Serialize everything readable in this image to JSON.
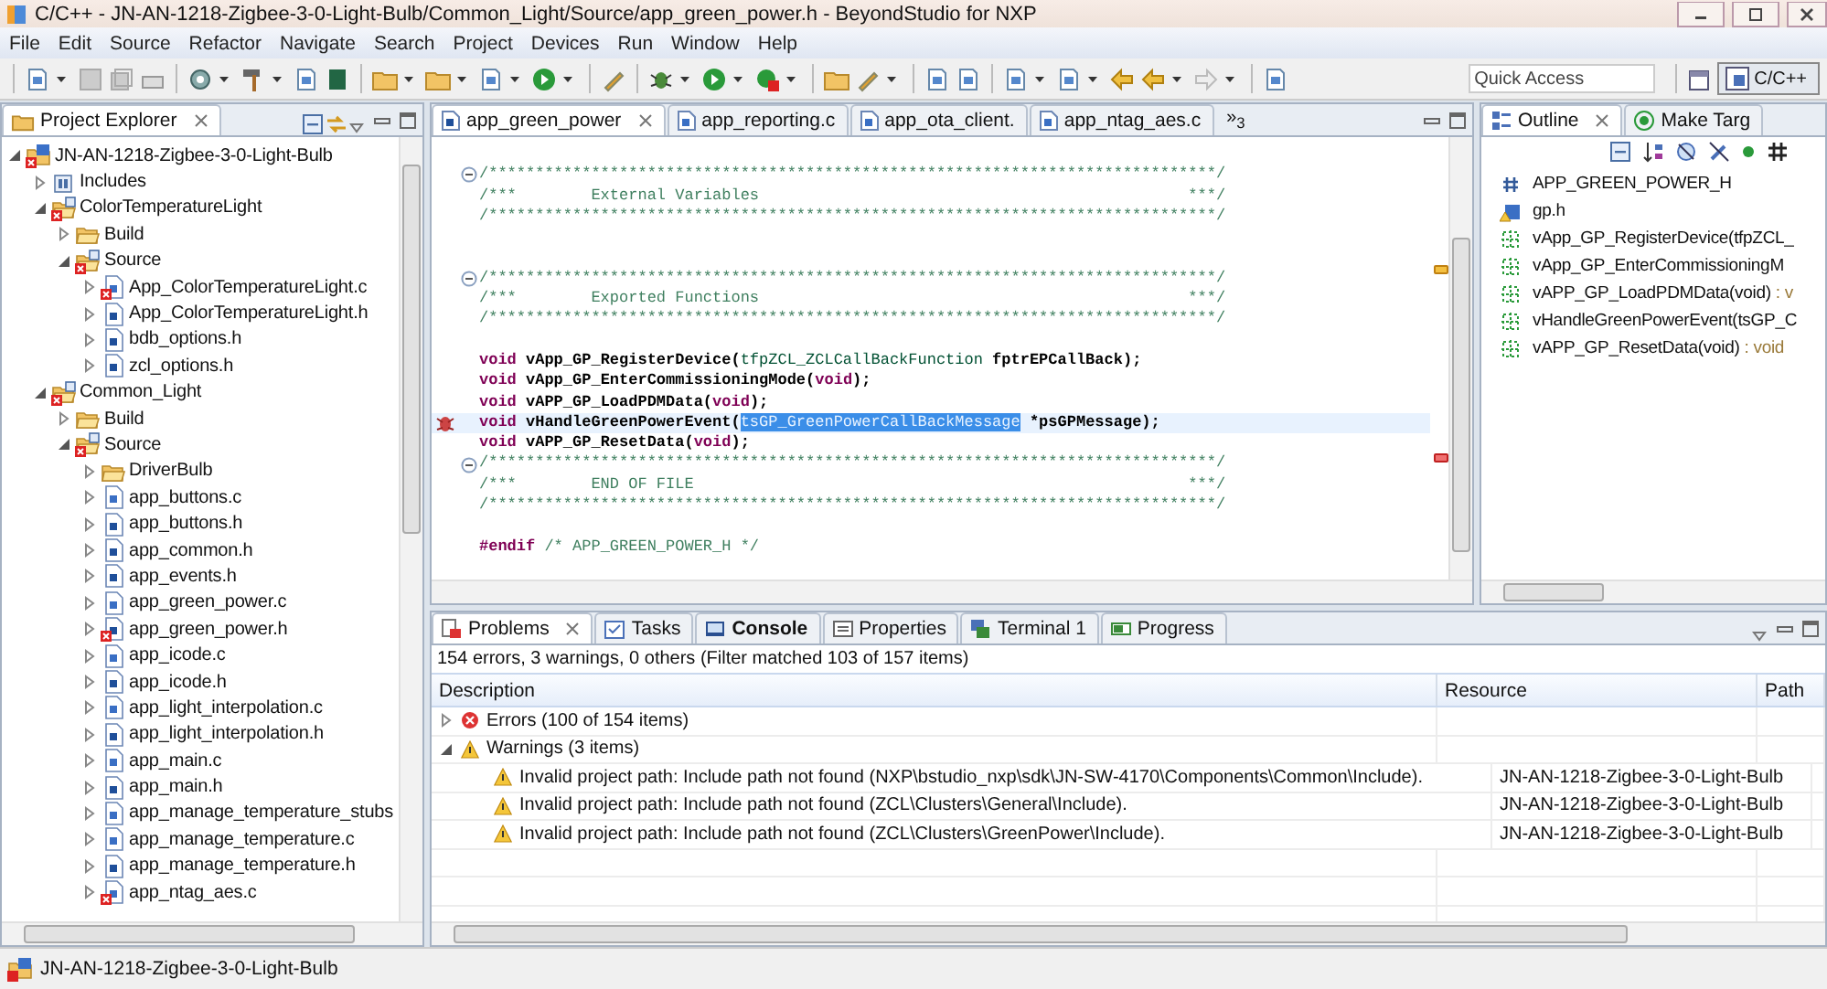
{
  "window": {
    "title": "C/C++ - JN-AN-1218-Zigbee-3-0-Light-Bulb/Common_Light/Source/app_green_power.h - BeyondStudio for NXP"
  },
  "menu": [
    "File",
    "Edit",
    "Source",
    "Refactor",
    "Navigate",
    "Search",
    "Project",
    "Devices",
    "Run",
    "Window",
    "Help"
  ],
  "toolbar": {
    "quick_access": {
      "placeholder": "Quick Access"
    },
    "perspective": {
      "label": "C/C++",
      "selected": true
    }
  },
  "project_explorer": {
    "title": "Project Explorer",
    "tree": [
      {
        "label": "JN-AN-1218-Zigbee-3-0-Light-Bulb",
        "kind": "project",
        "error": true,
        "expanded": true,
        "children": [
          {
            "label": "Includes",
            "kind": "library",
            "error": false,
            "expanded": false
          },
          {
            "label": "ColorTemperatureLight",
            "kind": "sourcefolder",
            "error": true,
            "expanded": true,
            "children": [
              {
                "label": "Build",
                "kind": "folder",
                "error": false,
                "expanded": false
              },
              {
                "label": "Source",
                "kind": "sourcefolder",
                "error": true,
                "expanded": true,
                "children": [
                  {
                    "label": "App_ColorTemperatureLight.c",
                    "kind": "c",
                    "error": true,
                    "expanded": false
                  },
                  {
                    "label": "App_ColorTemperatureLight.h",
                    "kind": "h",
                    "error": false,
                    "expanded": false
                  },
                  {
                    "label": "bdb_options.h",
                    "kind": "h",
                    "error": false,
                    "expanded": false
                  },
                  {
                    "label": "zcl_options.h",
                    "kind": "h",
                    "error": false,
                    "expanded": false
                  }
                ]
              }
            ]
          },
          {
            "label": "Common_Light",
            "kind": "sourcefolder",
            "error": true,
            "expanded": true,
            "children": [
              {
                "label": "Build",
                "kind": "folder",
                "error": false,
                "expanded": false
              },
              {
                "label": "Source",
                "kind": "sourcefolder",
                "error": true,
                "expanded": true,
                "children": [
                  {
                    "label": "DriverBulb",
                    "kind": "folder",
                    "error": false,
                    "expanded": false
                  },
                  {
                    "label": "app_buttons.c",
                    "kind": "c",
                    "error": false,
                    "expanded": false
                  },
                  {
                    "label": "app_buttons.h",
                    "kind": "h",
                    "error": false,
                    "expanded": false
                  },
                  {
                    "label": "app_common.h",
                    "kind": "h",
                    "error": false,
                    "expanded": false
                  },
                  {
                    "label": "app_events.h",
                    "kind": "h",
                    "error": false,
                    "expanded": false
                  },
                  {
                    "label": "app_green_power.c",
                    "kind": "c",
                    "error": false,
                    "expanded": false
                  },
                  {
                    "label": "app_green_power.h",
                    "kind": "h",
                    "error": true,
                    "expanded": false
                  },
                  {
                    "label": "app_icode.c",
                    "kind": "c",
                    "error": false,
                    "expanded": false
                  },
                  {
                    "label": "app_icode.h",
                    "kind": "h",
                    "error": false,
                    "expanded": false
                  },
                  {
                    "label": "app_light_interpolation.c",
                    "kind": "c",
                    "error": false,
                    "expanded": false
                  },
                  {
                    "label": "app_light_interpolation.h",
                    "kind": "h",
                    "error": false,
                    "expanded": false
                  },
                  {
                    "label": "app_main.c",
                    "kind": "c",
                    "error": false,
                    "expanded": false
                  },
                  {
                    "label": "app_main.h",
                    "kind": "h",
                    "error": false,
                    "expanded": false
                  },
                  {
                    "label": "app_manage_temperature_stubs",
                    "kind": "c",
                    "error": false,
                    "expanded": false
                  },
                  {
                    "label": "app_manage_temperature.c",
                    "kind": "c",
                    "error": false,
                    "expanded": false
                  },
                  {
                    "label": "app_manage_temperature.h",
                    "kind": "h",
                    "error": false,
                    "expanded": false
                  },
                  {
                    "label": "app_ntag_aes.c",
                    "kind": "c",
                    "error": true,
                    "expanded": false
                  }
                ]
              }
            ]
          }
        ]
      }
    ]
  },
  "editor": {
    "tabs": [
      {
        "label": "app_green_power",
        "kind": "h",
        "selected": true
      },
      {
        "label": "app_reporting.c",
        "kind": "c",
        "selected": false
      },
      {
        "label": "app_ota_client.",
        "kind": "c",
        "selected": false
      },
      {
        "label": "app_ntag_aes.c",
        "kind": "c",
        "selected": false
      }
    ],
    "overflow": "»$_{3}$",
    "lines": [
      {
        "fold": false,
        "current": false,
        "problem_marker": false
      },
      {
        "fold": true,
        "current": false,
        "problem_marker": false,
        "tokens": [
          {
            "text": "/******************************************************************************/",
            "kind": "comment"
          }
        ]
      },
      {
        "fold": false,
        "current": false,
        "problem_marker": false,
        "tokens": [
          {
            "text": "/***        External Variables                                              ***/",
            "kind": "comment"
          }
        ]
      },
      {
        "fold": false,
        "current": false,
        "problem_marker": false,
        "tokens": [
          {
            "text": "/******************************************************************************/",
            "kind": "comment"
          }
        ]
      },
      {
        "fold": false,
        "current": false,
        "problem_marker": false
      },
      {
        "fold": false,
        "current": false,
        "problem_marker": false
      },
      {
        "fold": true,
        "current": false,
        "problem_marker": false,
        "tokens": [
          {
            "text": "/******************************************************************************/",
            "kind": "comment"
          }
        ]
      },
      {
        "fold": false,
        "current": false,
        "problem_marker": false,
        "tokens": [
          {
            "text": "/***        Exported Functions                                              ***/",
            "kind": "comment"
          }
        ]
      },
      {
        "fold": false,
        "current": false,
        "problem_marker": false,
        "tokens": [
          {
            "text": "/******************************************************************************/",
            "kind": "comment"
          }
        ]
      },
      {
        "fold": false,
        "current": false,
        "problem_marker": false
      },
      {
        "fold": false,
        "current": false,
        "problem_marker": false,
        "tokens": [
          {
            "text": "void",
            "kind": "keyword"
          },
          {
            "text": " vApp_GP_RegisterDevice(",
            "kind": "code"
          },
          {
            "text": "tfpZCL_ZCLCallBackFunction",
            "kind": "type"
          },
          {
            "text": " fptrEPCallBack);",
            "kind": "code"
          }
        ]
      },
      {
        "fold": false,
        "current": false,
        "problem_marker": false,
        "tokens": [
          {
            "text": "void",
            "kind": "keyword"
          },
          {
            "text": " vApp_GP_EnterCommissioningMode(",
            "kind": "code"
          },
          {
            "text": "void",
            "kind": "keyword"
          },
          {
            "text": ");",
            "kind": "code"
          }
        ]
      },
      {
        "fold": false,
        "current": false,
        "problem_marker": false,
        "tokens": [
          {
            "text": "void",
            "kind": "keyword"
          },
          {
            "text": " vAPP_GP_LoadPDMData(",
            "kind": "code"
          },
          {
            "text": "void",
            "kind": "keyword"
          },
          {
            "text": ");",
            "kind": "code"
          }
        ]
      },
      {
        "fold": false,
        "current": true,
        "problem_marker": true,
        "tokens": [
          {
            "text": "void",
            "kind": "keyword"
          },
          {
            "text": " vHandleGreenPowerEvent(",
            "kind": "code"
          },
          {
            "text": "tsGP_GreenPowerCallBackMessage",
            "kind": "selected"
          },
          {
            "text": " *psGPMessage);",
            "kind": "code"
          }
        ]
      },
      {
        "fold": false,
        "current": false,
        "problem_marker": false,
        "tokens": [
          {
            "text": "void",
            "kind": "keyword"
          },
          {
            "text": " vAPP_GP_ResetData(",
            "kind": "code"
          },
          {
            "text": "void",
            "kind": "keyword"
          },
          {
            "text": ");",
            "kind": "code"
          }
        ]
      },
      {
        "fold": true,
        "current": false,
        "problem_marker": false,
        "tokens": [
          {
            "text": "/******************************************************************************/",
            "kind": "comment"
          }
        ]
      },
      {
        "fold": false,
        "current": false,
        "problem_marker": false,
        "tokens": [
          {
            "text": "/***        END OF FILE                                                     ***/",
            "kind": "comment"
          }
        ]
      },
      {
        "fold": false,
        "current": false,
        "problem_marker": false,
        "tokens": [
          {
            "text": "/******************************************************************************/",
            "kind": "comment"
          }
        ]
      },
      {
        "fold": false,
        "current": false,
        "problem_marker": false
      },
      {
        "fold": false,
        "current": false,
        "problem_marker": false,
        "tokens": [
          {
            "text": "#endif",
            "kind": "keyword"
          },
          {
            "text": " /* APP_GREEN_POWER_H */",
            "kind": "comment"
          }
        ]
      }
    ]
  },
  "outline": {
    "tabs": [
      {
        "label": "Outline",
        "selected": true
      },
      {
        "label": "Make Targ",
        "selected": false
      }
    ],
    "items": [
      {
        "kind": "macro",
        "label": "APP_GREEN_POWER_H"
      },
      {
        "kind": "include",
        "label": "gp.h"
      },
      {
        "kind": "function",
        "label": "vApp_GP_RegisterDevice(tfpZCL_"
      },
      {
        "kind": "function",
        "label": "vApp_GP_EnterCommissioningM"
      },
      {
        "kind": "function",
        "label": "vAPP_GP_LoadPDMData(void)",
        "type": " : v"
      },
      {
        "kind": "function",
        "label": "vHandleGreenPowerEvent(tsGP_C"
      },
      {
        "kind": "function",
        "label": "vAPP_GP_ResetData(void)",
        "type": " : void"
      }
    ]
  },
  "problems": {
    "tabs": [
      {
        "label": "Problems",
        "kind": "problems",
        "selected": true,
        "bold": false
      },
      {
        "label": "Tasks",
        "kind": "tasks",
        "selected": false,
        "bold": false
      },
      {
        "label": "Console",
        "kind": "console",
        "selected": false,
        "bold": true
      },
      {
        "label": "Properties",
        "kind": "properties",
        "selected": false,
        "bold": false
      },
      {
        "label": "Terminal 1",
        "kind": "terminal",
        "selected": false,
        "bold": false
      },
      {
        "label": "Progress",
        "kind": "progress",
        "selected": false,
        "bold": false
      }
    ],
    "summary": "154 errors, 3 warnings, 0 others (Filter matched 103 of 157 items)",
    "columns": [
      "Description",
      "Resource",
      "Path"
    ],
    "rows": [
      {
        "kind": "error",
        "expanded": false,
        "description": "Errors (100 of 154 items)"
      },
      {
        "kind": "warning",
        "expanded": true,
        "description": "Warnings (3 items)"
      },
      {
        "kind": "warning",
        "description": "Invalid project path: Include path not found (NXP\\bstudio_nxp\\sdk\\JN-SW-4170\\Components\\Common\\Include).",
        "resource": "JN-AN-1218-Zigbee-3-0-Light-Bulb"
      },
      {
        "kind": "warning",
        "description": "Invalid project path: Include path not found (ZCL\\Clusters\\General\\Include).",
        "resource": "JN-AN-1218-Zigbee-3-0-Light-Bulb"
      },
      {
        "kind": "warning",
        "description": "Invalid project path: Include path not found (ZCL\\Clusters\\GreenPower\\Include).",
        "resource": "JN-AN-1218-Zigbee-3-0-Light-Bulb"
      }
    ]
  },
  "status_bar": {
    "text": "JN-AN-1218-Zigbee-3-0-Light-Bulb"
  }
}
